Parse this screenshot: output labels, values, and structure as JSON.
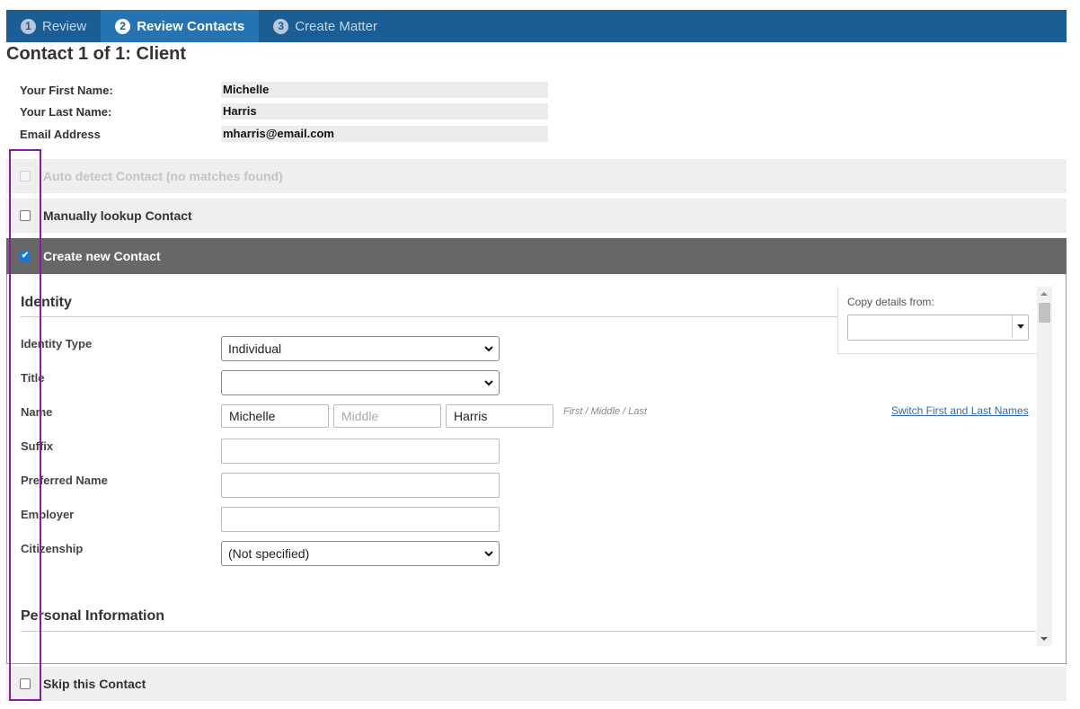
{
  "wizard": {
    "steps": [
      {
        "num": "1",
        "label": "Review"
      },
      {
        "num": "2",
        "label": "Review Contacts"
      },
      {
        "num": "3",
        "label": "Create Matter"
      }
    ]
  },
  "page_title": "Contact 1 of 1: Client",
  "summary": {
    "first_name_label": "Your First Name:",
    "first_name_value": "Michelle",
    "last_name_label": "Your Last Name:",
    "last_name_value": "Harris",
    "email_label": "Email Address",
    "email_value": "mharris@email.com"
  },
  "options": {
    "auto_detect": "Auto detect Contact (no matches found)",
    "manual_lookup": "Manually lookup Contact",
    "create_new": "Create new Contact",
    "skip": "Skip this Contact"
  },
  "identity": {
    "heading": "Identity",
    "identity_type_label": "Identity Type",
    "identity_type_value": "Individual",
    "title_label": "Title",
    "title_value": "",
    "name_label": "Name",
    "first": "Michelle",
    "middle_placeholder": "Middle",
    "last": "Harris",
    "name_hint": "First / Middle / Last",
    "switch_link": "Switch First and Last Names",
    "suffix_label": "Suffix",
    "preferred_label": "Preferred Name",
    "employer_label": "Employer",
    "citizenship_label": "Citizenship",
    "citizenship_value": "(Not specified)",
    "copy_from_label": "Copy details from:"
  },
  "personal": {
    "heading": "Personal Information"
  }
}
